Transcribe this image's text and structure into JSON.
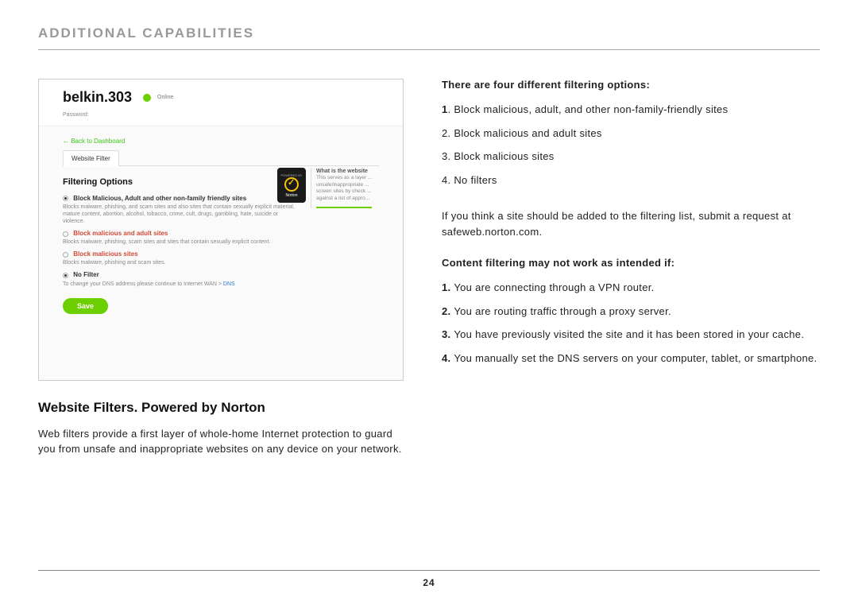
{
  "page": {
    "title": "ADDITIONAL CAPABILITIES",
    "section_title": "Website Filters. Powered by Norton",
    "intro": "Web filters provide a first layer of whole-home Internet protection to guard you from unsafe and inappropriate websites on any device on your network.",
    "page_number": "24"
  },
  "screenshot": {
    "router_name": "belkin.303",
    "status": "Online",
    "password_label": "Password:",
    "back_link": "← Back to Dashboard",
    "tab": "Website Filter",
    "heading": "Filtering Options",
    "options": [
      {
        "label": "Block Malicious, Adult and other non-family friendly sites",
        "selected": true,
        "red": false,
        "desc": "Blocks malware, phishing, and scam sites and also sites that contain sexually explicit material, mature content, abortion, alcohol, tobacco, crime, cult, drugs, gambling, hate, suicide or violence."
      },
      {
        "label": "Block malicious and adult sites",
        "selected": false,
        "red": true,
        "desc": "Blocks malware, phishing, scam sites and sites that contain sexually explicit content."
      },
      {
        "label": "Block malicious sites",
        "selected": false,
        "red": true,
        "desc": "Blocks malware, phishing and scam sites."
      },
      {
        "label": "No Filter",
        "selected": true,
        "red": false,
        "desc": ""
      }
    ],
    "dns_pre": "To change your DNS address please continue to Internet WAN > ",
    "dns_link": "DNS",
    "save": "Save",
    "sidebar_title": "What is the website",
    "sidebar_body": "This serves as a layer ... unsafe/inappropriate ... screen sites by check ... against a list of appro...",
    "norton_label": "Norton",
    "norton_powered": "POWERED BY"
  },
  "right": {
    "h1": "There are four different filtering options:",
    "list1": [
      "Block malicious, adult, and other non-family-friendly sites",
      "Block malicious and adult sites",
      "Block malicious sites",
      "No filters"
    ],
    "note": "If you think a site should be added to the filtering list, submit a request at safeweb.norton.com.",
    "h2": "Content filtering may not work as intended if:",
    "list2": [
      "You are connecting through a VPN router.",
      "You are routing traffic through a proxy server.",
      "You have previously visited the site and it has been stored in your cache.",
      "You manually set the DNS servers on your computer, tablet, or smartphone."
    ]
  }
}
